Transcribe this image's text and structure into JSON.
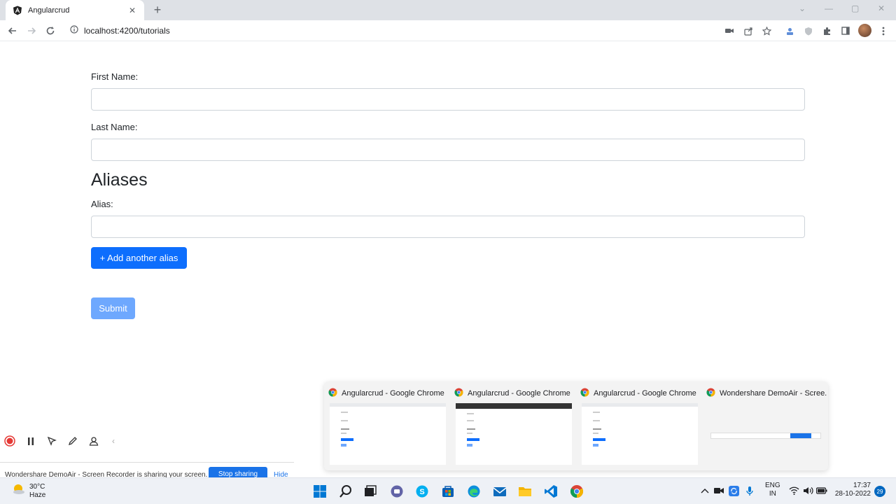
{
  "browser": {
    "tab_title": "Angularcrud",
    "url": "localhost:4200/tutorials"
  },
  "form": {
    "first_name_label": "First Name:",
    "first_name_value": "",
    "last_name_label": "Last Name:",
    "last_name_value": "",
    "aliases_heading": "Aliases",
    "alias_label": "Alias:",
    "alias_value": "",
    "add_alias_button": "+ Add another alias",
    "submit_button": "Submit"
  },
  "thumbnails": [
    {
      "title": "Angularcrud - Google Chrome"
    },
    {
      "title": "Angularcrud - Google Chrome"
    },
    {
      "title": "Angularcrud - Google Chrome"
    },
    {
      "title": "Wondershare DemoAir - Scree..."
    }
  ],
  "recorder": {
    "sharing_message": "Wondershare DemoAir - Screen Recorder is sharing your screen.",
    "stop_sharing": "Stop sharing",
    "hide": "Hide"
  },
  "taskbar": {
    "temperature": "30°C",
    "condition": "Haze",
    "lang_top": "ENG",
    "lang_bottom": "IN",
    "time": "17:37",
    "date": "28-10-2022",
    "notification_count": "29"
  },
  "colors": {
    "primary": "#0d6efd",
    "primary_disabled": "#6ea8fe",
    "tabbar": "#dee1e6",
    "taskbar": "#eef1f6"
  }
}
